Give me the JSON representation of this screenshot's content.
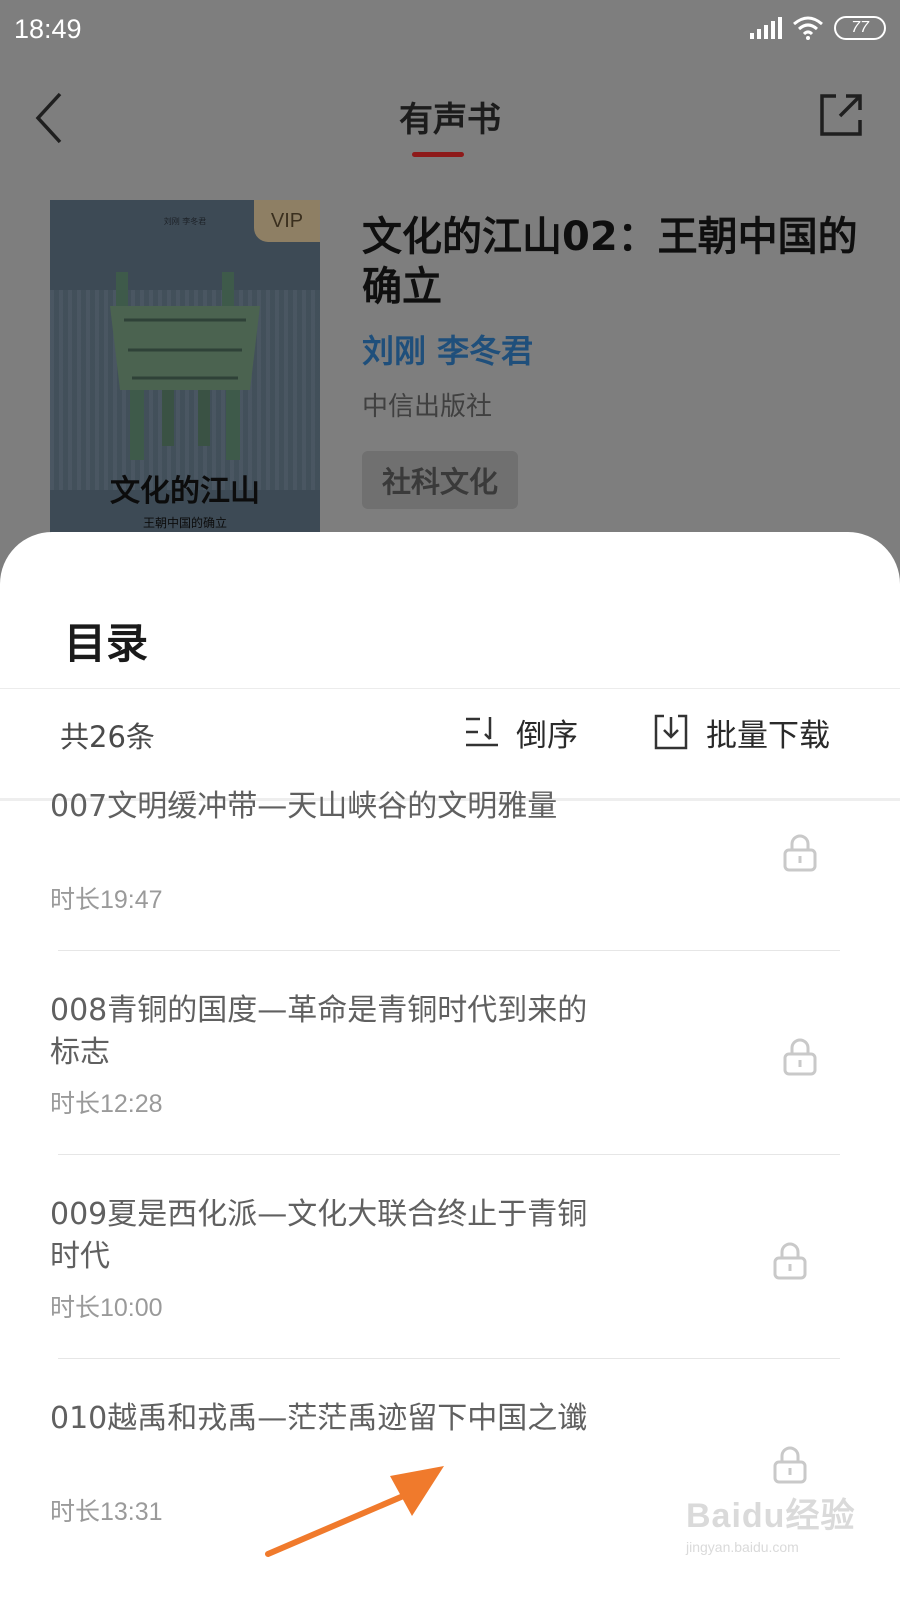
{
  "status_bar": {
    "time": "18:49",
    "battery": "77"
  },
  "header": {
    "title": "有声书"
  },
  "book": {
    "cover_authors_small": "刘刚 李冬君",
    "cover_title": "文化的江山",
    "cover_subtitle": "王朝中国的确立",
    "vip_badge": "VIP",
    "title": "文化的江山02：王朝中国的确立",
    "authors": "刘刚 李冬君",
    "publisher": "中信出版社",
    "tag": "社科文化"
  },
  "catalog": {
    "title": "目录",
    "count": "共26条",
    "sort_label": "倒序",
    "download_label": "批量下载",
    "episodes": [
      {
        "title": "007文明缓冲带—天山峡谷的文明雅量",
        "duration": "时长19:47"
      },
      {
        "title": "008青铜的国度—革命是青铜时代到来的标志",
        "duration": "时长12:28"
      },
      {
        "title": "009夏是西化派—文化大联合终止于青铜时代",
        "duration": "时长10:00"
      },
      {
        "title": "010越禹和戎禹—茫茫禹迹留下中国之谶",
        "duration": "时长13:31"
      }
    ]
  },
  "watermark": {
    "brand": "Baidu经验",
    "url": "jingyan.baidu.com"
  },
  "colors": {
    "accent_red": "#c8282a",
    "author_blue": "#2d7fc4",
    "arrow_orange": "#f07a2c"
  }
}
